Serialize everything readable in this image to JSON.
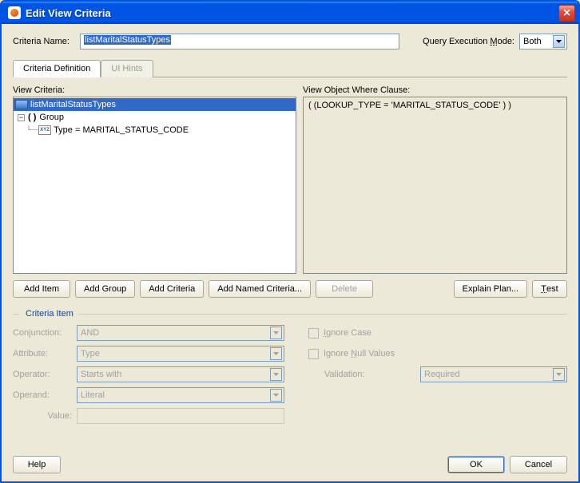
{
  "window_title": "Edit View Criteria",
  "criteria_name_label": "Criteria Name:",
  "criteria_name_value": "listMaritalStatusTypes",
  "query_exec_label": "Query Execution Mode:",
  "query_exec_value": "Both",
  "tabs": {
    "definition": "Criteria Definition",
    "hints": "UI Hints"
  },
  "view_criteria_label": "View Criteria:",
  "tree": {
    "root": "listMaritalStatusTypes",
    "group": "Group",
    "group_paren": "( )",
    "leaf": "Type = MARITAL_STATUS_CODE"
  },
  "where_label": "View Object Where Clause:",
  "where_text": "( (LOOKUP_TYPE = 'MARITAL_STATUS_CODE' ) )",
  "buttons": {
    "add_item": "Add Item",
    "add_group": "Add Group",
    "add_criteria": "Add Criteria",
    "add_named": "Add Named Criteria...",
    "delete": "Delete",
    "explain": "Explain Plan...",
    "test": "Test"
  },
  "criteria_item_legend": "Criteria Item",
  "form": {
    "conjunction_label": "Conjunction:",
    "conjunction_value": "AND",
    "attribute_label": "Attribute:",
    "attribute_value": "Type",
    "operator_label": "Operator:",
    "operator_value": "Starts with",
    "operand_label": "Operand:",
    "operand_value": "Literal",
    "value_label": "Value:",
    "value_value": "",
    "ignore_case": "Ignore Case",
    "ignore_null": "Ignore Null Values",
    "validation_label": "Validation:",
    "validation_value": "Required"
  },
  "bottom": {
    "help": "Help",
    "ok": "OK",
    "cancel": "Cancel"
  }
}
